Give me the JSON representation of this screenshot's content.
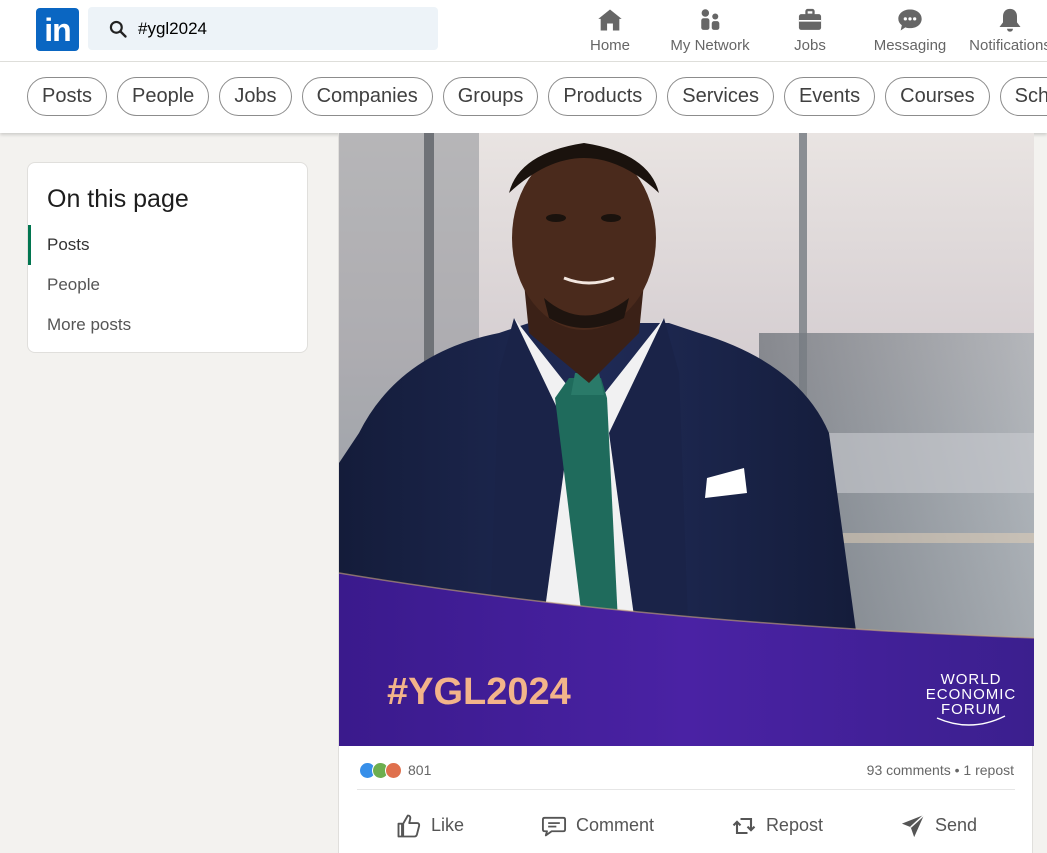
{
  "app": {
    "logo_text": "in",
    "brand_color": "#0a66c2"
  },
  "search": {
    "value": "#ygl2024"
  },
  "nav": [
    {
      "label": "Home",
      "icon": "home-icon"
    },
    {
      "label": "My Network",
      "icon": "network-icon"
    },
    {
      "label": "Jobs",
      "icon": "briefcase-icon"
    },
    {
      "label": "Messaging",
      "icon": "messaging-icon"
    },
    {
      "label": "Notifications",
      "icon": "bell-icon"
    }
  ],
  "filters": [
    "Posts",
    "People",
    "Jobs",
    "Companies",
    "Groups",
    "Products",
    "Services",
    "Events",
    "Courses",
    "Schools"
  ],
  "on_this_page": {
    "title": "On this page",
    "items": [
      {
        "label": "Posts",
        "active": true
      },
      {
        "label": "People",
        "active": false
      },
      {
        "label": "More posts",
        "active": false
      }
    ],
    "accent_color": "#01754f"
  },
  "post": {
    "image": {
      "hashtag": "#YGL2024",
      "org_line1": "WORLD",
      "org_line2": "ECONOMIC",
      "org_line3": "FORUM",
      "banner_color": "#4b1fa0"
    },
    "reactions_count": "801",
    "comments": "93 comments",
    "separator": "•",
    "reposts": "1 repost",
    "actions": [
      {
        "label": "Like",
        "icon": "thumbs-up-icon"
      },
      {
        "label": "Comment",
        "icon": "comment-icon"
      },
      {
        "label": "Repost",
        "icon": "repost-icon"
      },
      {
        "label": "Send",
        "icon": "send-icon"
      }
    ]
  }
}
